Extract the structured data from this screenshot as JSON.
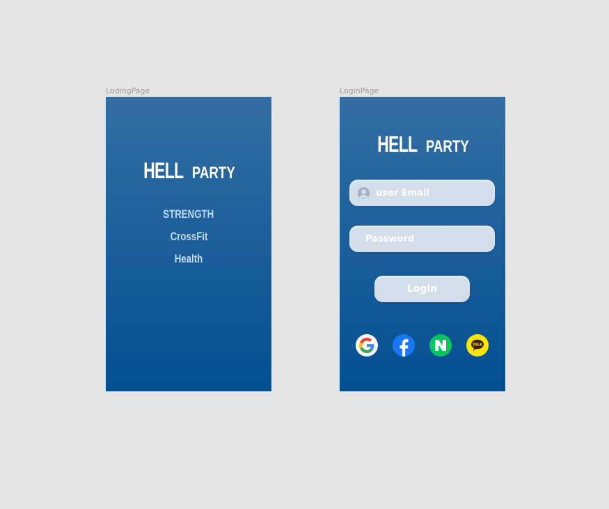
{
  "loading_page": {
    "frame_label": "LodingPage",
    "logo_big": "HELL",
    "logo_small": "PARTY",
    "taglines": [
      "STRENGTH",
      "CrossFit",
      "Health"
    ]
  },
  "login_page": {
    "frame_label": "LoginPage",
    "logo_big": "HELL",
    "logo_small": "PARTY",
    "email_placeholder": "user Email",
    "password_placeholder": "Password",
    "login_label": "Login",
    "social_buttons": [
      {
        "icon": "google-icon",
        "bg": "#ffffff"
      },
      {
        "icon": "facebook-icon",
        "bg": "#1877f2"
      },
      {
        "icon": "naver-icon",
        "bg": "#03c75a"
      },
      {
        "icon": "kakaotalk-icon",
        "bg": "#fee500",
        "text": "TALK"
      }
    ]
  },
  "colors": {
    "canvas": "#e5e5e5",
    "gradient_top": "#336ea3",
    "gradient_bottom": "#034f91",
    "input_fill": "#d2deea"
  }
}
